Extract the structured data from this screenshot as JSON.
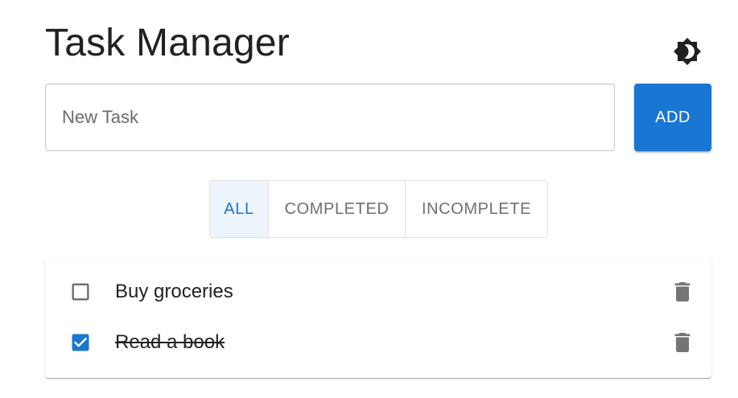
{
  "header": {
    "title": "Task Manager",
    "theme_icon": "brightness-icon"
  },
  "new_task": {
    "placeholder": "New Task",
    "value": "",
    "add_label": "ADD"
  },
  "filters": [
    {
      "label": "ALL",
      "active": true
    },
    {
      "label": "COMPLETED",
      "active": false
    },
    {
      "label": "INCOMPLETE",
      "active": false
    }
  ],
  "tasks": [
    {
      "text": "Buy groceries",
      "completed": false
    },
    {
      "text": "Read a book",
      "completed": true
    }
  ],
  "colors": {
    "accent": "#1976d2",
    "active_filter_bg": "#edf4fc",
    "icon_gray": "#757575",
    "text": "#212121"
  }
}
